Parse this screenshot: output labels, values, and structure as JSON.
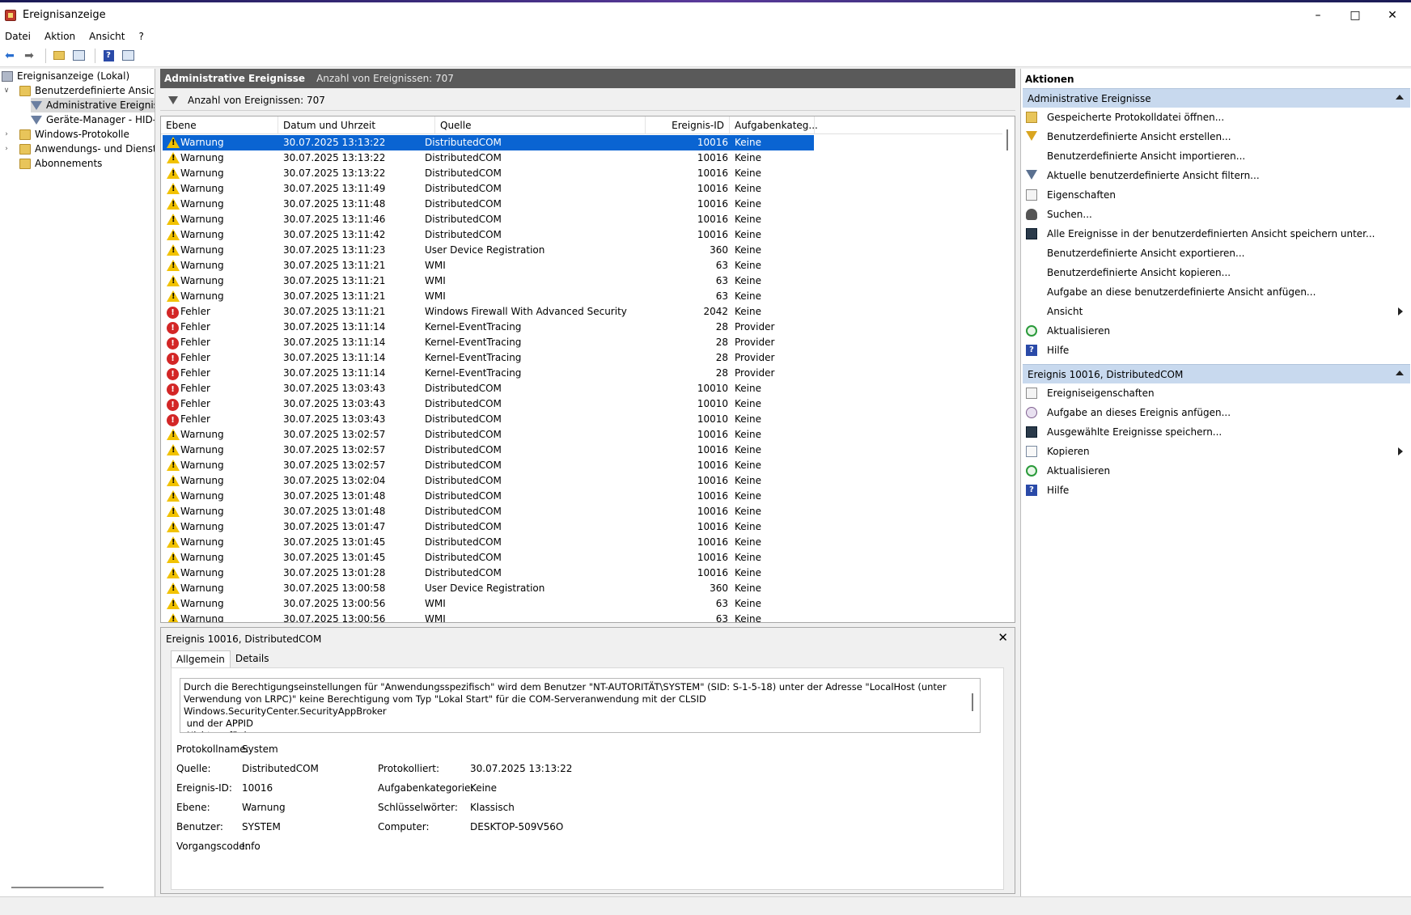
{
  "window": {
    "title": "Ereignisanzeige"
  },
  "menu": [
    "Datei",
    "Aktion",
    "Ansicht",
    "?"
  ],
  "tree": [
    {
      "label": "Ereignisanzeige (Lokal)",
      "indent": 0,
      "expander": "",
      "icon": "event-viewer-icon"
    },
    {
      "label": "Benutzerdefinierte Ansichten",
      "indent": 1,
      "expander": "v",
      "icon": "folder-icon"
    },
    {
      "label": "Administrative Ereignisse",
      "indent": 2,
      "expander": "",
      "icon": "filter-icon",
      "selected": true
    },
    {
      "label": "Geräte-Manager - HID-konforme Maus",
      "indent": 2,
      "expander": "",
      "icon": "filter-icon"
    },
    {
      "label": "Windows-Protokolle",
      "indent": 1,
      "expander": ">",
      "icon": "folder-icon"
    },
    {
      "label": "Anwendungs- und Dienstprotokolle",
      "indent": 1,
      "expander": ">",
      "icon": "folder-icon"
    },
    {
      "label": "Abonnements",
      "indent": 1,
      "expander": "",
      "icon": "folder-icon"
    }
  ],
  "center": {
    "title": "Administrative Ereignisse",
    "count_label": "Anzahl von Ereignissen: 707",
    "filter_label": "Anzahl von Ereignissen: 707",
    "columns": [
      "Ebene",
      "Datum und Uhrzeit",
      "Quelle",
      "Ereignis-ID",
      "Aufgabenkateg..."
    ]
  },
  "events": [
    {
      "level": "Warnung",
      "type": "warn",
      "date": "30.07.2025 13:13:22",
      "source": "DistributedCOM",
      "id": "10016",
      "category": "Keine",
      "selected": true
    },
    {
      "level": "Warnung",
      "type": "warn",
      "date": "30.07.2025 13:13:22",
      "source": "DistributedCOM",
      "id": "10016",
      "category": "Keine"
    },
    {
      "level": "Warnung",
      "type": "warn",
      "date": "30.07.2025 13:13:22",
      "source": "DistributedCOM",
      "id": "10016",
      "category": "Keine"
    },
    {
      "level": "Warnung",
      "type": "warn",
      "date": "30.07.2025 13:11:49",
      "source": "DistributedCOM",
      "id": "10016",
      "category": "Keine"
    },
    {
      "level": "Warnung",
      "type": "warn",
      "date": "30.07.2025 13:11:48",
      "source": "DistributedCOM",
      "id": "10016",
      "category": "Keine"
    },
    {
      "level": "Warnung",
      "type": "warn",
      "date": "30.07.2025 13:11:46",
      "source": "DistributedCOM",
      "id": "10016",
      "category": "Keine"
    },
    {
      "level": "Warnung",
      "type": "warn",
      "date": "30.07.2025 13:11:42",
      "source": "DistributedCOM",
      "id": "10016",
      "category": "Keine"
    },
    {
      "level": "Warnung",
      "type": "warn",
      "date": "30.07.2025 13:11:23",
      "source": "User Device Registration",
      "id": "360",
      "category": "Keine"
    },
    {
      "level": "Warnung",
      "type": "warn",
      "date": "30.07.2025 13:11:21",
      "source": "WMI",
      "id": "63",
      "category": "Keine"
    },
    {
      "level": "Warnung",
      "type": "warn",
      "date": "30.07.2025 13:11:21",
      "source": "WMI",
      "id": "63",
      "category": "Keine"
    },
    {
      "level": "Warnung",
      "type": "warn",
      "date": "30.07.2025 13:11:21",
      "source": "WMI",
      "id": "63",
      "category": "Keine"
    },
    {
      "level": "Fehler",
      "type": "err",
      "date": "30.07.2025 13:11:21",
      "source": "Windows Firewall With Advanced Security",
      "id": "2042",
      "category": "Keine"
    },
    {
      "level": "Fehler",
      "type": "err",
      "date": "30.07.2025 13:11:14",
      "source": "Kernel-EventTracing",
      "id": "28",
      "category": "Provider"
    },
    {
      "level": "Fehler",
      "type": "err",
      "date": "30.07.2025 13:11:14",
      "source": "Kernel-EventTracing",
      "id": "28",
      "category": "Provider"
    },
    {
      "level": "Fehler",
      "type": "err",
      "date": "30.07.2025 13:11:14",
      "source": "Kernel-EventTracing",
      "id": "28",
      "category": "Provider"
    },
    {
      "level": "Fehler",
      "type": "err",
      "date": "30.07.2025 13:11:14",
      "source": "Kernel-EventTracing",
      "id": "28",
      "category": "Provider"
    },
    {
      "level": "Fehler",
      "type": "err",
      "date": "30.07.2025 13:03:43",
      "source": "DistributedCOM",
      "id": "10010",
      "category": "Keine"
    },
    {
      "level": "Fehler",
      "type": "err",
      "date": "30.07.2025 13:03:43",
      "source": "DistributedCOM",
      "id": "10010",
      "category": "Keine"
    },
    {
      "level": "Fehler",
      "type": "err",
      "date": "30.07.2025 13:03:43",
      "source": "DistributedCOM",
      "id": "10010",
      "category": "Keine"
    },
    {
      "level": "Warnung",
      "type": "warn",
      "date": "30.07.2025 13:02:57",
      "source": "DistributedCOM",
      "id": "10016",
      "category": "Keine"
    },
    {
      "level": "Warnung",
      "type": "warn",
      "date": "30.07.2025 13:02:57",
      "source": "DistributedCOM",
      "id": "10016",
      "category": "Keine"
    },
    {
      "level": "Warnung",
      "type": "warn",
      "date": "30.07.2025 13:02:57",
      "source": "DistributedCOM",
      "id": "10016",
      "category": "Keine"
    },
    {
      "level": "Warnung",
      "type": "warn",
      "date": "30.07.2025 13:02:04",
      "source": "DistributedCOM",
      "id": "10016",
      "category": "Keine"
    },
    {
      "level": "Warnung",
      "type": "warn",
      "date": "30.07.2025 13:01:48",
      "source": "DistributedCOM",
      "id": "10016",
      "category": "Keine"
    },
    {
      "level": "Warnung",
      "type": "warn",
      "date": "30.07.2025 13:01:48",
      "source": "DistributedCOM",
      "id": "10016",
      "category": "Keine"
    },
    {
      "level": "Warnung",
      "type": "warn",
      "date": "30.07.2025 13:01:47",
      "source": "DistributedCOM",
      "id": "10016",
      "category": "Keine"
    },
    {
      "level": "Warnung",
      "type": "warn",
      "date": "30.07.2025 13:01:45",
      "source": "DistributedCOM",
      "id": "10016",
      "category": "Keine"
    },
    {
      "level": "Warnung",
      "type": "warn",
      "date": "30.07.2025 13:01:45",
      "source": "DistributedCOM",
      "id": "10016",
      "category": "Keine"
    },
    {
      "level": "Warnung",
      "type": "warn",
      "date": "30.07.2025 13:01:28",
      "source": "DistributedCOM",
      "id": "10016",
      "category": "Keine"
    },
    {
      "level": "Warnung",
      "type": "warn",
      "date": "30.07.2025 13:00:58",
      "source": "User Device Registration",
      "id": "360",
      "category": "Keine"
    },
    {
      "level": "Warnung",
      "type": "warn",
      "date": "30.07.2025 13:00:56",
      "source": "WMI",
      "id": "63",
      "category": "Keine"
    },
    {
      "level": "Warnung",
      "type": "warn",
      "date": "30.07.2025 13:00:56",
      "source": "WMI",
      "id": "63",
      "category": "Keine"
    }
  ],
  "detail": {
    "title": "Ereignis 10016, DistributedCOM",
    "tabs": [
      "Allgemein",
      "Details"
    ],
    "message": "Durch die Berechtigungseinstellungen für \"Anwendungsspezifisch\" wird dem Benutzer \"NT-AUTORITÄT\\SYSTEM\" (SID: S-1-5-18) unter der Adresse \"LocalHost (unter Verwendung von LRPC)\" keine Berechtigung vom Typ \"Lokal Start\" für die COM-Serveranwendung mit der CLSID\nWindows.SecurityCenter.SecurityAppBroker\n und der APPID\n Nicht verfügbar",
    "labels": {
      "log": "Protokollname:",
      "source": "Quelle:",
      "event_id": "Ereignis-ID:",
      "level": "Ebene:",
      "user": "Benutzer:",
      "opcode": "Vorgangscode:",
      "logged": "Protokolliert:",
      "task": "Aufgabenkategorie:",
      "keywords": "Schlüsselwörter:",
      "computer": "Computer:"
    },
    "values": {
      "log": "System",
      "source": "DistributedCOM",
      "event_id": "10016",
      "level": "Warnung",
      "user": "SYSTEM",
      "opcode": "Info",
      "logged": "30.07.2025 13:13:22",
      "task": "Keine",
      "keywords": "Klassisch",
      "computer": "DESKTOP-509V56O"
    }
  },
  "actions": {
    "header": "Aktionen",
    "sections": [
      {
        "title": "Administrative Ereignisse",
        "items": [
          {
            "label": "Gespeicherte Protokolldatei öffnen...",
            "icon": "open-log-icon"
          },
          {
            "label": "Benutzerdefinierte Ansicht erstellen...",
            "icon": "create-view-icon"
          },
          {
            "label": "Benutzerdefinierte Ansicht importieren...",
            "icon": ""
          },
          {
            "label": "Aktuelle benutzerdefinierte Ansicht filtern...",
            "icon": "filter-icon"
          },
          {
            "label": "Eigenschaften",
            "icon": "properties-icon"
          },
          {
            "label": "Suchen...",
            "icon": "find-icon"
          },
          {
            "label": "Alle Ereignisse in der benutzerdefinierten Ansicht speichern unter...",
            "icon": "save-icon"
          },
          {
            "label": "Benutzerdefinierte Ansicht exportieren...",
            "icon": ""
          },
          {
            "label": "Benutzerdefinierte Ansicht kopieren...",
            "icon": ""
          },
          {
            "label": "Aufgabe an diese benutzerdefinierte Ansicht anfügen...",
            "icon": ""
          },
          {
            "label": "Ansicht",
            "icon": "",
            "submenu": true
          },
          {
            "label": "Aktualisieren",
            "icon": "refresh-icon"
          },
          {
            "label": "Hilfe",
            "icon": "help-icon"
          }
        ]
      },
      {
        "title": "Ereignis 10016, DistributedCOM",
        "items": [
          {
            "label": "Ereigniseigenschaften",
            "icon": "properties-icon"
          },
          {
            "label": "Aufgabe an dieses Ereignis anfügen...",
            "icon": "attach-task-icon"
          },
          {
            "label": "Ausgewählte Ereignisse speichern...",
            "icon": "save-icon"
          },
          {
            "label": "Kopieren",
            "icon": "copy-icon",
            "submenu": true
          },
          {
            "label": "Aktualisieren",
            "icon": "refresh-icon"
          },
          {
            "label": "Hilfe",
            "icon": "help-icon"
          }
        ]
      }
    ]
  }
}
